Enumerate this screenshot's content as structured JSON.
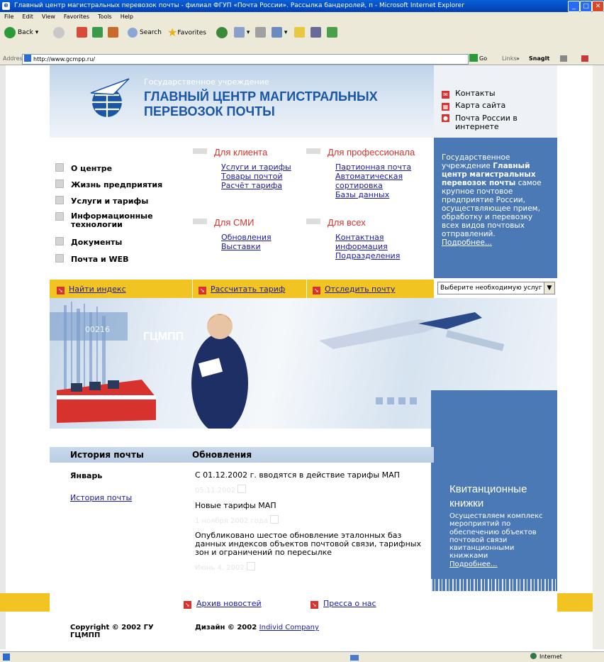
{
  "window": {
    "title": "Главный центр магистральных перевозок почты - филиал ФГУП «Почта России». Рассылка бандеролей, п - Microsoft Internet Explorer"
  },
  "menubar": [
    "File",
    "Edit",
    "View",
    "Favorites",
    "Tools",
    "Help"
  ],
  "toolbar": {
    "back": "Back",
    "search": "Search",
    "favorites": "Favorites"
  },
  "address": {
    "label": "Address",
    "url": "http://www.gcmpp.ru/",
    "go": "Go",
    "links": "Links",
    "snagit": "SnagIt"
  },
  "header": {
    "small": "Государственное учреждение",
    "big_line1": "ГЛАВНЫЙ ЦЕНТР МАГИСТРАЛЬНЫХ",
    "big_line2": "ПЕРЕВОЗОК ПОЧТЫ",
    "links": [
      "Контакты",
      "Карта сайта",
      "Почта России в интернете"
    ]
  },
  "left_menu": [
    "О центре",
    "Жизнь предприятия",
    "Услуги и тарифы",
    "Информационные технологии",
    "Документы",
    "Почта и WEB"
  ],
  "sections": {
    "client": {
      "title": "Для клиента",
      "links": [
        "Услуги и тарифы",
        "Товары почтой",
        "Расчёт тарифа"
      ]
    },
    "pro": {
      "title": "Для профессионала",
      "links": [
        "Партионная почта",
        "Автоматическая сортировка",
        "Базы данных"
      ]
    },
    "media": {
      "title": "Для СМИ",
      "links": [
        "Обновления",
        "Выставки"
      ]
    },
    "all": {
      "title": "Для всех",
      "links": [
        "Контактная информация",
        "Подразделения"
      ]
    }
  },
  "about": {
    "text_pre": "Государственное учреждение ",
    "text_bold": "Главный центр магистральных перевозок почты",
    "text_post": " самое крупное почтовое предприятие России, осуществляющее прием, обработку и перевозку всех видов почтовых отправлений.",
    "more": "Подробнее..."
  },
  "quickbar": {
    "links": [
      "Найти индекс",
      "Рассчитать тариф",
      "Отследить почту"
    ],
    "select": "Выберите необходимую услуг"
  },
  "banner": {
    "brand": "ГЦМПП",
    "number": "00216"
  },
  "kvit": {
    "title": "Квитанционные книжки",
    "text": "Осуществляем комплекс мероприятий по обеспечению объектов почтовой связи квитанционными книжками",
    "more": "Подробнее..."
  },
  "history": {
    "heading": "История почты",
    "month": "Январь",
    "link": "История почты"
  },
  "news": {
    "heading": "Обновления",
    "items": [
      {
        "text": "С 01.12.2002 г. вводятся в действие тарифы МАП",
        "date": "05.11.2002"
      },
      {
        "text": "Новые тарифы МАП",
        "date": "1 ноября 2002 года"
      },
      {
        "text": "Опубликовано шестое обновление эталонных баз данных индексов объектов почтовой связи, тарифных зон и ограничений по пересылке",
        "date": "Июнь 4, 2002"
      }
    ]
  },
  "footer": {
    "links": [
      "Архив новостей",
      "Пресса о нас"
    ],
    "copyright": "Copyright © 2002 ГУ ГЦМПП",
    "design_label": "Дизайн © 2002 ",
    "design_link": "Individ Company"
  },
  "status": {
    "zone": "Internet"
  }
}
